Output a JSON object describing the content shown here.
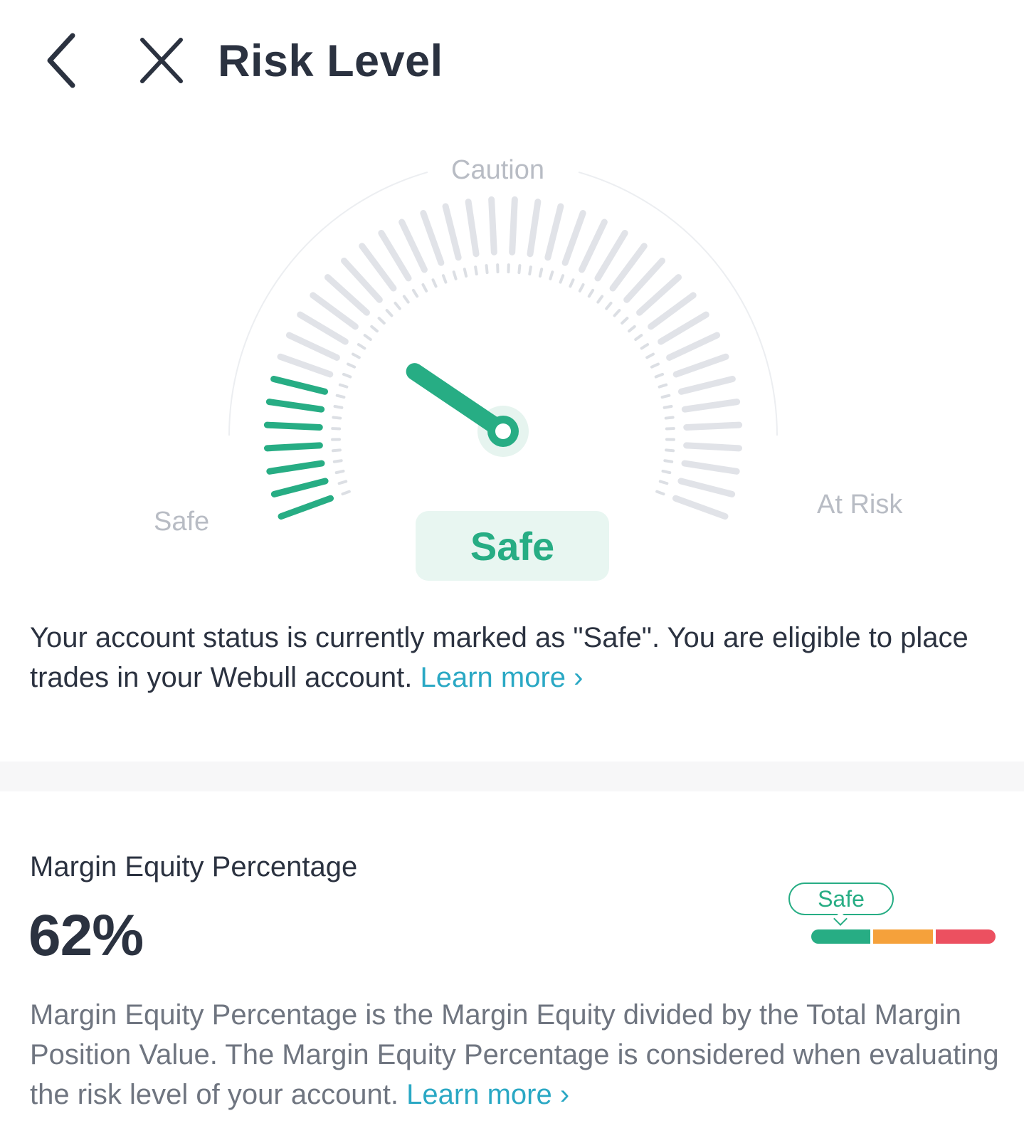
{
  "header": {
    "title": "Risk Level",
    "back_icon": "chevron-left-icon",
    "close_icon": "close-icon"
  },
  "gauge": {
    "zone_labels": {
      "caution": "Caution",
      "safe": "Safe",
      "at_risk": "At Risk"
    },
    "status": "Safe",
    "active_fraction": 0.18,
    "active_color": "#27ad84",
    "inactive_color": "#e1e3e8"
  },
  "status_message": {
    "text": "Your account status is currently marked as \"Safe\". You are eligible to place trades in your Webull account.",
    "link": "Learn more ›"
  },
  "margin_equity": {
    "title": "Margin Equity Percentage",
    "value": "62%",
    "indicator_label": "Safe",
    "indicator_colors": [
      "#27ad84",
      "#f5a13b",
      "#ec5060"
    ],
    "description": "Margin Equity Percentage is the Margin Equity divided by the Total Margin Position Value. The Margin Equity Percentage is considered when evaluating the risk level of your account.",
    "link": "Learn more ›"
  }
}
